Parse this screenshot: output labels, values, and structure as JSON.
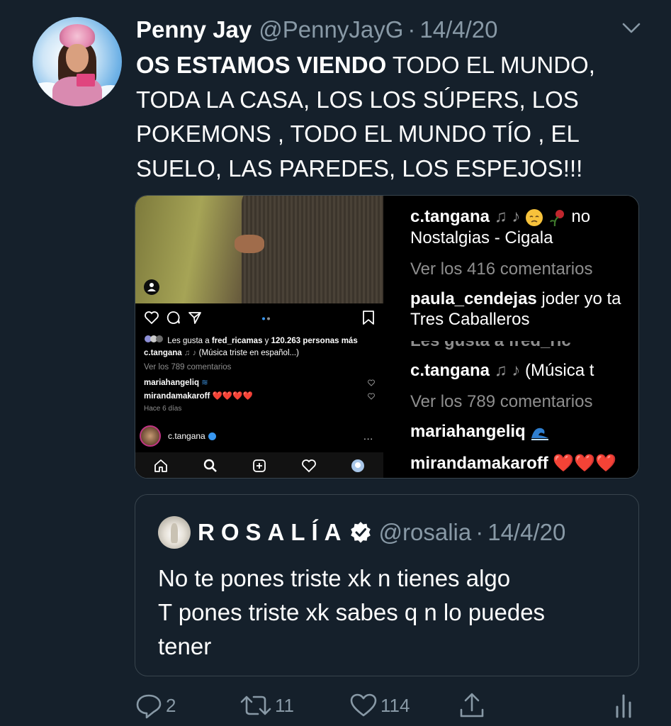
{
  "tweet": {
    "author_name": "Penny Jay",
    "author_handle": "@PennyJayG",
    "separator": "·",
    "date": "14/4/20",
    "text_bold": "OS ESTAMOS VIENDO",
    "text_rest": " TODO EL MUNDO, TODA LA CASA, LOS LOS SÚPERS, LOS POKEMONS , TODO EL MUNDO TÍO , EL SUELO,  LAS PAREDES, LOS ESPEJOS!!!"
  },
  "media": {
    "left": {
      "likes_prefix": "Les gusta a ",
      "likes_user": "fred_ricamas",
      "likes_mid": " y ",
      "likes_count": "120.263 personas más",
      "caption_user": "c.tangana",
      "caption_text": "(Música triste en español...)",
      "view_comments": "Ver los 789 comentarios",
      "comment1_user": "mariahangeliq",
      "comment2_user": "mirandamakaroff",
      "comment2_text": "❤️❤️❤️❤️",
      "time_ago": "Hace 6 días",
      "account": "c.tangana",
      "more": "..."
    },
    "right_top": {
      "line1_user": "c.tangana",
      "line1_text": " no",
      "line2": "Nostalgias - Cigala",
      "line3": "Ver los 416 comentarios",
      "line4_user": "paula_cendejas",
      "line4_text": " joder yo ta",
      "line5": "Tres Caballeros"
    },
    "right_bottom": {
      "line0": "Les gusta a fred_ric",
      "line1_user": "c.tangana",
      "line1_text": " (Música t",
      "line2": "Ver los 789 comentarios",
      "line3_user": "mariahangeliq",
      "line4_user": "mirandamakaroff",
      "line4_text": "❤️❤️❤️"
    }
  },
  "quote": {
    "author_name": "ROSALÍA",
    "author_handle": "@rosalia",
    "separator": "·",
    "date": "14/4/20",
    "text_line1": "No te pones triste xk n tienes algo",
    "text_line2": "T pones triste xk sabes q n lo puedes",
    "text_line3": "tener"
  },
  "actions": {
    "replies": "2",
    "retweets": "11",
    "likes": "114"
  },
  "colors": {
    "background": "#15202b",
    "muted": "#8899a6",
    "border": "#38444d",
    "heart_red": "#ed4956"
  }
}
